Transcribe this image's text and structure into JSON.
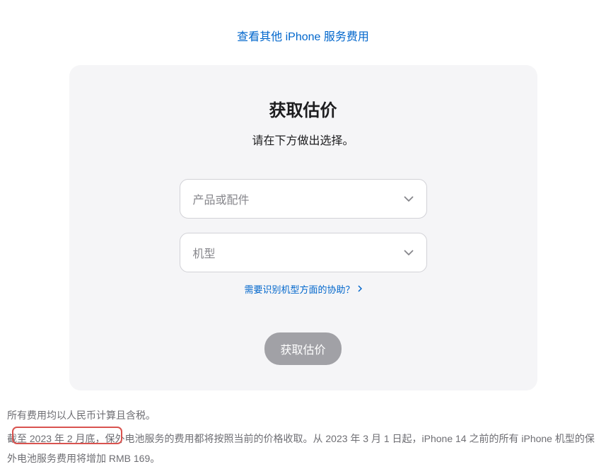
{
  "topLink": {
    "text": "查看其他 iPhone 服务费用"
  },
  "card": {
    "title": "获取估价",
    "subtitle": "请在下方做出选择。",
    "select1": {
      "placeholder": "产品或配件"
    },
    "select2": {
      "placeholder": "机型"
    },
    "helpLink": "需要识别机型方面的协助？",
    "submitLabel": "获取估价"
  },
  "footer": {
    "line1": "所有费用均以人民币计算且含税。",
    "line2": "截至 2023 年 2 月底，保外电池服务的费用都将按照当前的价格收取。从 2023 年 3 月 1 日起，iPhone 14 之前的所有 iPhone 机型的保外电池服务费用将增加 RMB 169。"
  }
}
